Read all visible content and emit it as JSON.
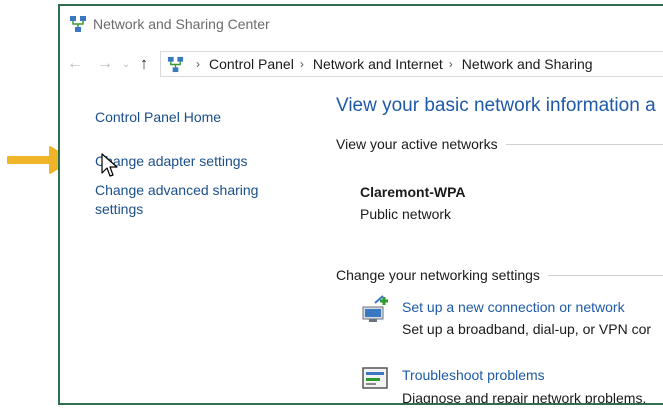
{
  "window": {
    "title": "Network and Sharing Center"
  },
  "address_bar": {
    "crumbs": [
      "Control Panel",
      "Network and Internet",
      "Network and Sharing"
    ]
  },
  "left_pane": {
    "links": [
      "Control Panel Home",
      "Change adapter settings",
      "Change advanced sharing",
      "settings"
    ]
  },
  "main": {
    "heading": "View your basic network information a",
    "active_networks_label": "View your active networks",
    "network": {
      "name": "Claremont-WPA",
      "type": "Public network"
    },
    "change_settings_label": "Change your networking settings",
    "tasks": [
      {
        "link": "Set up a new connection or network",
        "description": "Set up a broadband, dial-up, or VPN cor",
        "icon": "network-connection-icon"
      },
      {
        "link": "Troubleshoot problems",
        "description": "Diagnose and repair network problems,",
        "icon": "troubleshoot-icon"
      }
    ]
  },
  "colors": {
    "window_border": "#2f6e4e",
    "link": "#1e5aa8",
    "arrow": "#f0b429"
  }
}
